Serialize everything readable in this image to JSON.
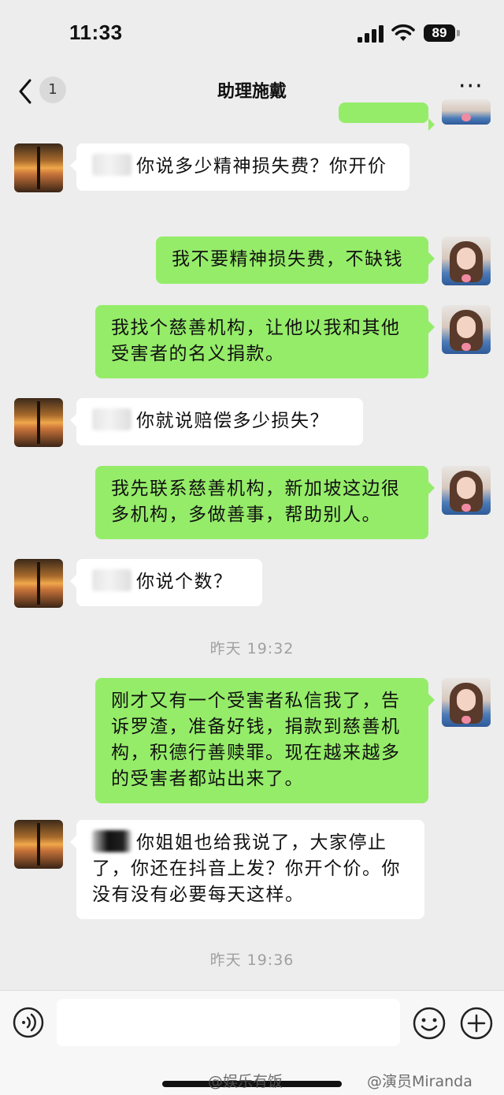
{
  "status_bar": {
    "time": "11:33",
    "battery": "89"
  },
  "nav": {
    "unread_count": "1",
    "title": "助理施戴",
    "more_label": "···"
  },
  "messages": [
    {
      "side": "left",
      "text": "你说多少精神损失费？你开价"
    },
    {
      "side": "right",
      "text": "我不要精神损失费，不缺钱"
    },
    {
      "side": "right",
      "text": "我找个慈善机构，让他以我和其他受害者的名义捐款。"
    },
    {
      "side": "left",
      "text": "你就说赔偿多少损失？"
    },
    {
      "side": "right",
      "text": "我先联系慈善机构，新加坡这边很多机构，多做善事，帮助别人。"
    },
    {
      "side": "left",
      "text": "你说个数？"
    },
    {
      "side": "right",
      "text": "刚才又有一个受害者私信我了，告诉罗渣，准备好钱，捐款到慈善机构，积德行善赎罪。现在越来越多的受害者都站出来了。"
    },
    {
      "side": "left",
      "text": "你姐姐也给我说了，大家停止了，你还在抖音上发？你开个价。你没有没有必要每天这样。"
    }
  ],
  "timestamps": [
    "昨天 19:32",
    "昨天 19:36"
  ],
  "watermarks": {
    "left": "@娱乐有饭",
    "right": "@演员Miranda"
  },
  "icons": {
    "back": "chevron-left-icon",
    "voice": "voice-icon",
    "emoji": "emoji-icon",
    "plus": "plus-icon",
    "signal": "signal-icon",
    "wifi": "wifi-icon"
  },
  "colors": {
    "outgoing_bubble": "#95ec69",
    "incoming_bubble": "#ffffff",
    "background": "#ededed"
  }
}
